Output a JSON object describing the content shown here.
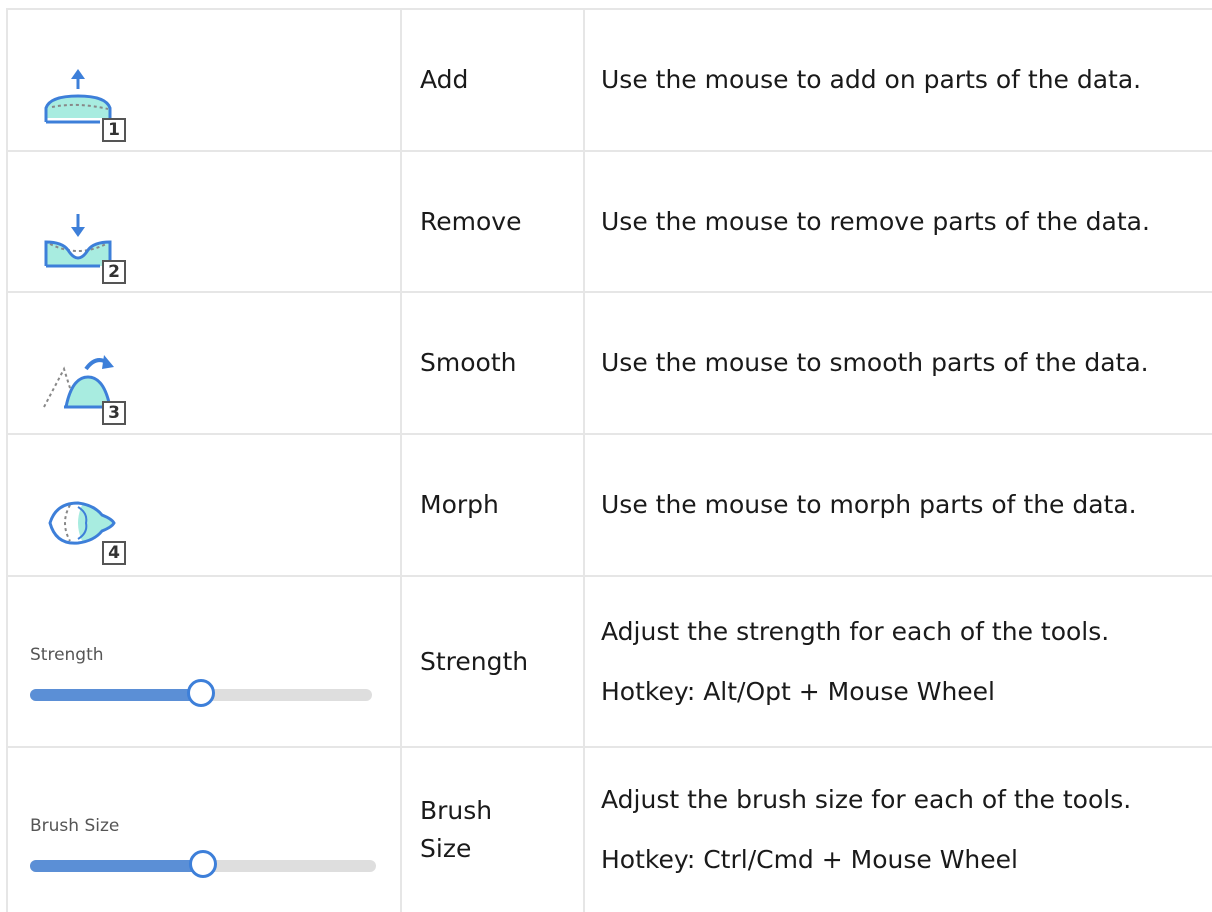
{
  "rows": [
    {
      "icon": "add-icon",
      "key": "1",
      "name": "Add",
      "description": [
        "Use the mouse to add on parts of the data."
      ]
    },
    {
      "icon": "remove-icon",
      "key": "2",
      "name": "Remove",
      "description": [
        "Use the mouse to remove parts of the data."
      ]
    },
    {
      "icon": "smooth-icon",
      "key": "3",
      "name": "Smooth",
      "description": [
        "Use the mouse to smooth parts of the data."
      ]
    },
    {
      "icon": "morph-icon",
      "key": "4",
      "name": "Morph",
      "description": [
        "Use the mouse to morph parts of the data."
      ]
    },
    {
      "icon": "strength-slider",
      "slider_label": "Strength",
      "slider_value": 0.5,
      "name": "Strength",
      "description": [
        "Adjust the strength for each of the tools.",
        "Hotkey: Alt/Opt + Mouse Wheel"
      ]
    },
    {
      "icon": "brush-size-slider",
      "slider_label": "Brush Size",
      "slider_value": 0.5,
      "name": "Brush Size",
      "description": [
        "Adjust the brush size for each of the tools.",
        "Hotkey: Ctrl/Cmd + Mouse Wheel"
      ]
    }
  ],
  "colors": {
    "accent": "#3d7fd9",
    "fill": "#a8ece0",
    "slider_fill": "#5b8fd6",
    "grid": "#e6e6e6"
  }
}
